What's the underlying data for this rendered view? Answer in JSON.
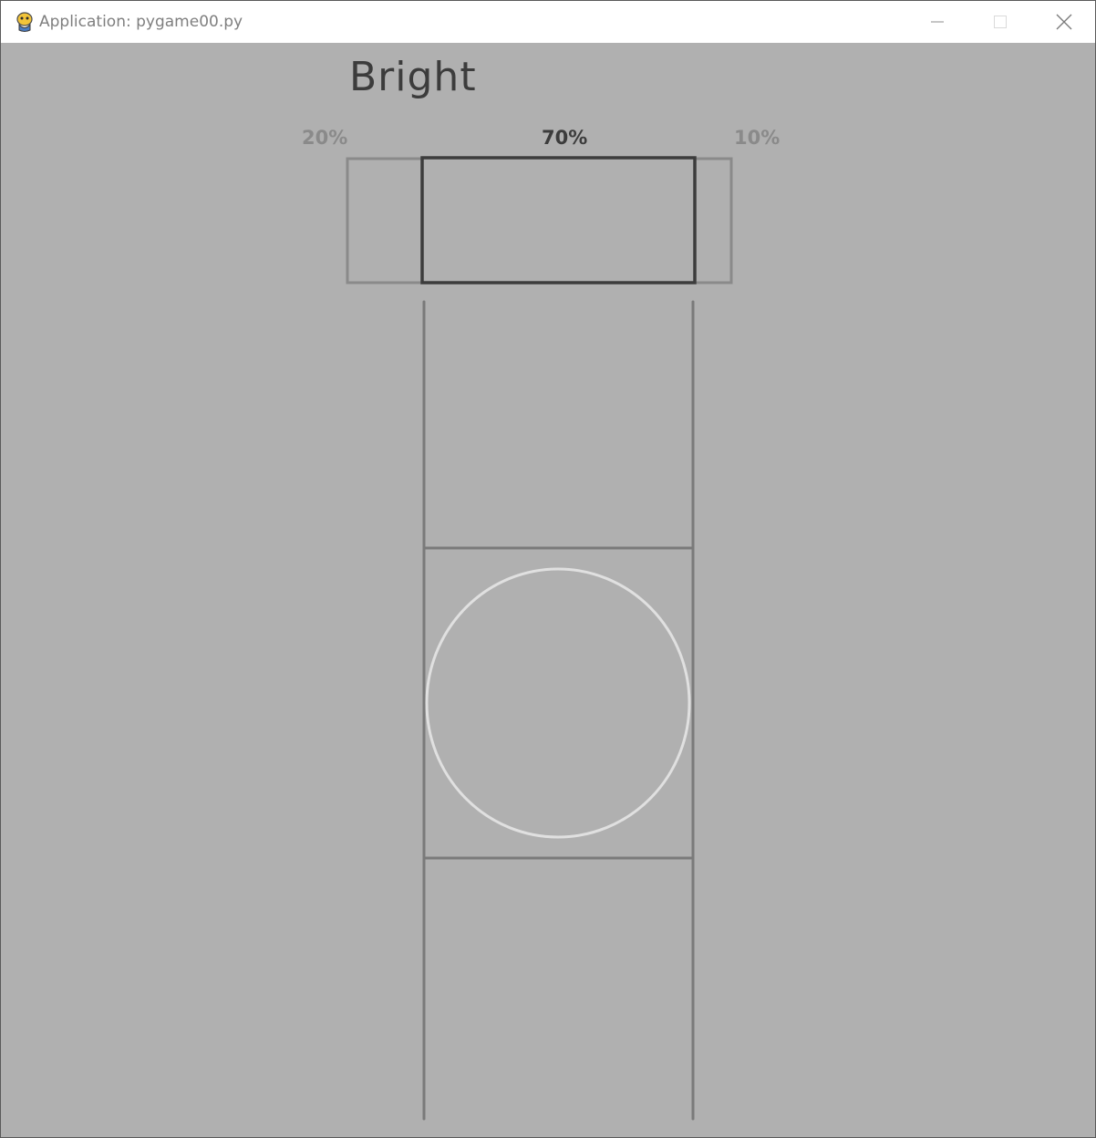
{
  "window": {
    "title": "Application: pygame00.py",
    "app_icon": "pygame-snake-icon",
    "controls": {
      "minimize_icon": "minimize-icon",
      "maximize_icon": "maximize-icon",
      "close_icon": "close-icon"
    }
  },
  "canvas": {
    "background": "#b0b0b0",
    "heading": "Bright",
    "options": [
      {
        "label": "20%",
        "selected": false
      },
      {
        "label": "70%",
        "selected": true
      },
      {
        "label": "10%",
        "selected": false
      }
    ],
    "colors": {
      "selected": "#3c3c3c",
      "unselected": "#8a8a8a",
      "lines": "#7a7a7a",
      "circle": "#e0e0e0"
    }
  }
}
